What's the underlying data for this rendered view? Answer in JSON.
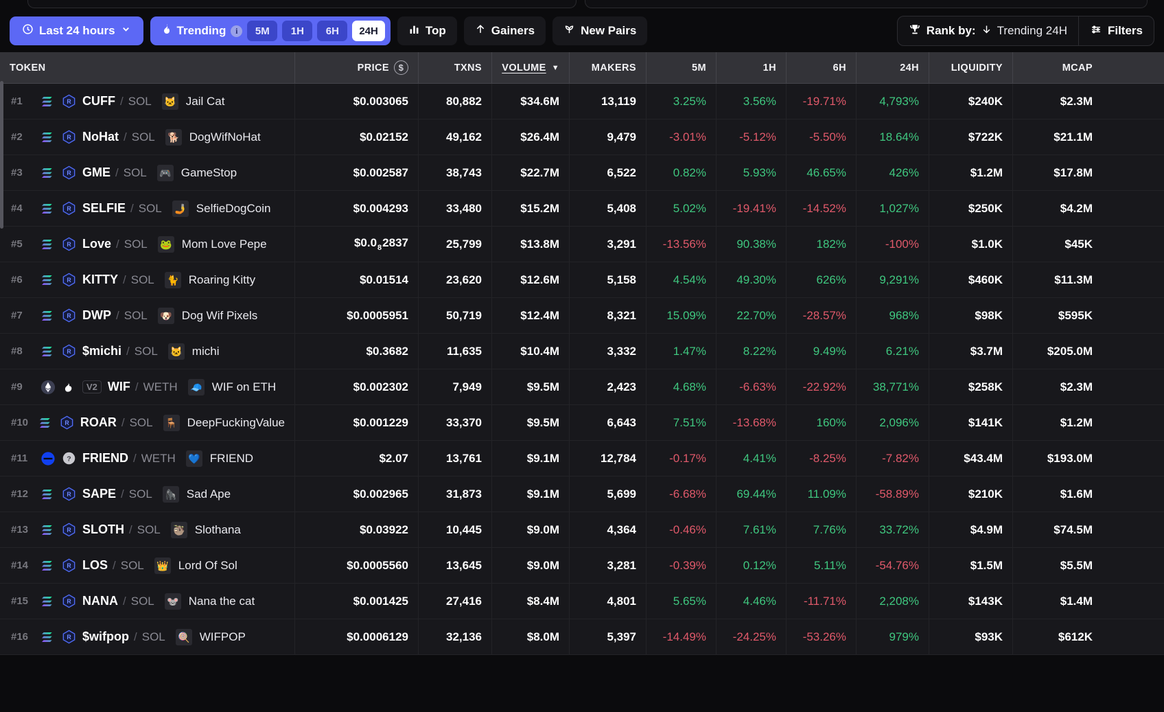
{
  "toolbar": {
    "timeframe_button": {
      "label": "Last 24 hours",
      "icon": "clock-icon",
      "chevron": "chevron-down-icon"
    },
    "trending": {
      "label": "Trending",
      "icon": "flame-icon",
      "info": "i",
      "options": [
        "5M",
        "1H",
        "6H",
        "24H"
      ],
      "active": "24H"
    },
    "tabs": [
      {
        "label": "Top",
        "icon": "bar-chart-icon"
      },
      {
        "label": "Gainers",
        "icon": "arrow-up-icon"
      },
      {
        "label": "New Pairs",
        "icon": "sprout-icon"
      }
    ],
    "rank_by": {
      "icon": "trophy-icon",
      "label": "Rank by:",
      "sort_icon": "arrow-down-icon",
      "value": "Trending 24H"
    },
    "filters": {
      "label": "Filters",
      "icon": "sliders-icon"
    }
  },
  "colors": {
    "accent": "#5c68f5",
    "up": "#3fc77f",
    "down": "#e0596a",
    "header_bg": "#333338",
    "row_bg": "#18181c"
  },
  "table": {
    "columns": [
      {
        "key": "token",
        "label": "TOKEN"
      },
      {
        "key": "price",
        "label": "PRICE",
        "badge": "$"
      },
      {
        "key": "txns",
        "label": "TXNS"
      },
      {
        "key": "volume",
        "label": "VOLUME",
        "sorted": true,
        "caret": "▼"
      },
      {
        "key": "makers",
        "label": "MAKERS"
      },
      {
        "key": "m5",
        "label": "5M"
      },
      {
        "key": "h1",
        "label": "1H"
      },
      {
        "key": "h6",
        "label": "6H"
      },
      {
        "key": "h24",
        "label": "24H"
      },
      {
        "key": "liquidity",
        "label": "LIQUIDITY"
      },
      {
        "key": "mcap",
        "label": "MCAP"
      }
    ],
    "rows": [
      {
        "rank": "#1",
        "chain": "solana-icon",
        "dex": "raydium-icon",
        "symbol": "CUFF",
        "quote": "SOL",
        "name": "Jail Cat",
        "avatar": "🐱",
        "price": "$0.003065",
        "txns": "80,882",
        "volume": "$34.6M",
        "makers": "13,119",
        "m5": "3.25%",
        "h1": "3.56%",
        "h6": "-19.71%",
        "h24": "4,793%",
        "liquidity": "$240K",
        "mcap": "$2.3M"
      },
      {
        "rank": "#2",
        "chain": "solana-icon",
        "dex": "raydium-icon",
        "symbol": "NoHat",
        "quote": "SOL",
        "name": "DogWifNoHat",
        "avatar": "🐕",
        "price": "$0.02152",
        "txns": "49,162",
        "volume": "$26.4M",
        "makers": "9,479",
        "m5": "-3.01%",
        "h1": "-5.12%",
        "h6": "-5.50%",
        "h24": "18.64%",
        "liquidity": "$722K",
        "mcap": "$21.1M"
      },
      {
        "rank": "#3",
        "chain": "solana-icon",
        "dex": "raydium-icon",
        "symbol": "GME",
        "quote": "SOL",
        "name": "GameStop",
        "avatar": "🎮",
        "price": "$0.002587",
        "txns": "38,743",
        "volume": "$22.7M",
        "makers": "6,522",
        "m5": "0.82%",
        "h1": "5.93%",
        "h6": "46.65%",
        "h24": "426%",
        "liquidity": "$1.2M",
        "mcap": "$17.8M"
      },
      {
        "rank": "#4",
        "chain": "solana-icon",
        "dex": "raydium-icon",
        "symbol": "SELFIE",
        "quote": "SOL",
        "name": "SelfieDogCoin",
        "avatar": "🤳",
        "price": "$0.004293",
        "txns": "33,480",
        "volume": "$15.2M",
        "makers": "5,408",
        "m5": "5.02%",
        "h1": "-19.41%",
        "h6": "-14.52%",
        "h24": "1,027%",
        "liquidity": "$250K",
        "mcap": "$4.2M"
      },
      {
        "rank": "#5",
        "chain": "solana-icon",
        "dex": "raydium-icon",
        "symbol": "Love",
        "quote": "SOL",
        "name": "Mom Love Pepe",
        "avatar": "🐸",
        "price": "$0.0",
        "price_sub": "8",
        "price_tail": "2837",
        "txns": "25,799",
        "volume": "$13.8M",
        "makers": "3,291",
        "m5": "-13.56%",
        "h1": "90.38%",
        "h6": "182%",
        "h24": "-100%",
        "liquidity": "$1.0K",
        "mcap": "$45K"
      },
      {
        "rank": "#6",
        "chain": "solana-icon",
        "dex": "raydium-icon",
        "symbol": "KITTY",
        "quote": "SOL",
        "name": "Roaring Kitty",
        "avatar": "🐈",
        "price": "$0.01514",
        "txns": "23,620",
        "volume": "$12.6M",
        "makers": "5,158",
        "m5": "4.54%",
        "h1": "49.30%",
        "h6": "626%",
        "h24": "9,291%",
        "liquidity": "$460K",
        "mcap": "$11.3M"
      },
      {
        "rank": "#7",
        "chain": "solana-icon",
        "dex": "raydium-icon",
        "symbol": "DWP",
        "quote": "SOL",
        "name": "Dog Wif Pixels",
        "avatar": "🐶",
        "price": "$0.0005951",
        "txns": "50,719",
        "volume": "$12.4M",
        "makers": "8,321",
        "m5": "15.09%",
        "h1": "22.70%",
        "h6": "-28.57%",
        "h24": "968%",
        "liquidity": "$98K",
        "mcap": "$595K"
      },
      {
        "rank": "#8",
        "chain": "solana-icon",
        "dex": "raydium-icon",
        "symbol": "$michi",
        "quote": "SOL",
        "name": "michi",
        "avatar": "🐱",
        "price": "$0.3682",
        "txns": "11,635",
        "volume": "$10.4M",
        "makers": "3,332",
        "m5": "1.47%",
        "h1": "8.22%",
        "h6": "9.49%",
        "h24": "6.21%",
        "liquidity": "$3.7M",
        "mcap": "$205.0M"
      },
      {
        "rank": "#9",
        "chain": "ethereum-icon",
        "dex": "uniswap-icon",
        "version": "V2",
        "symbol": "WIF",
        "quote": "WETH",
        "name": "WIF on ETH",
        "avatar": "🧢",
        "price": "$0.002302",
        "txns": "7,949",
        "volume": "$9.5M",
        "makers": "2,423",
        "m5": "4.68%",
        "h1": "-6.63%",
        "h6": "-22.92%",
        "h24": "38,771%",
        "liquidity": "$258K",
        "mcap": "$2.3M"
      },
      {
        "rank": "#10",
        "chain": "solana-icon",
        "dex": "raydium-icon",
        "symbol": "ROAR",
        "quote": "SOL",
        "name": "DeepFuckingValue",
        "avatar": "🪑",
        "price": "$0.001229",
        "txns": "33,370",
        "volume": "$9.5M",
        "makers": "6,643",
        "m5": "7.51%",
        "h1": "-13.68%",
        "h6": "160%",
        "h24": "2,096%",
        "liquidity": "$141K",
        "mcap": "$1.2M"
      },
      {
        "rank": "#11",
        "chain": "base-icon",
        "dex": "unknown-dex-icon",
        "symbol": "FRIEND",
        "quote": "WETH",
        "name": "FRIEND",
        "avatar": "💙",
        "price": "$2.07",
        "txns": "13,761",
        "volume": "$9.1M",
        "makers": "12,784",
        "m5": "-0.17%",
        "h1": "4.41%",
        "h6": "-8.25%",
        "h24": "-7.82%",
        "liquidity": "$43.4M",
        "mcap": "$193.0M"
      },
      {
        "rank": "#12",
        "chain": "solana-icon",
        "dex": "raydium-icon",
        "symbol": "SAPE",
        "quote": "SOL",
        "name": "Sad Ape",
        "avatar": "🦍",
        "price": "$0.002965",
        "txns": "31,873",
        "volume": "$9.1M",
        "makers": "5,699",
        "m5": "-6.68%",
        "h1": "69.44%",
        "h6": "11.09%",
        "h24": "-58.89%",
        "liquidity": "$210K",
        "mcap": "$1.6M"
      },
      {
        "rank": "#13",
        "chain": "solana-icon",
        "dex": "raydium-icon",
        "symbol": "SLOTH",
        "quote": "SOL",
        "name": "Slothana",
        "avatar": "🦥",
        "price": "$0.03922",
        "txns": "10,445",
        "volume": "$9.0M",
        "makers": "4,364",
        "m5": "-0.46%",
        "h1": "7.61%",
        "h6": "7.76%",
        "h24": "33.72%",
        "liquidity": "$4.9M",
        "mcap": "$74.5M"
      },
      {
        "rank": "#14",
        "chain": "solana-icon",
        "dex": "raydium-icon",
        "symbol": "LOS",
        "quote": "SOL",
        "name": "Lord Of Sol",
        "avatar": "👑",
        "price": "$0.0005560",
        "txns": "13,645",
        "volume": "$9.0M",
        "makers": "3,281",
        "m5": "-0.39%",
        "h1": "0.12%",
        "h6": "5.11%",
        "h24": "-54.76%",
        "liquidity": "$1.5M",
        "mcap": "$5.5M"
      },
      {
        "rank": "#15",
        "chain": "solana-icon",
        "dex": "raydium-icon",
        "symbol": "NANA",
        "quote": "SOL",
        "name": "Nana the cat",
        "avatar": "🐭",
        "price": "$0.001425",
        "txns": "27,416",
        "volume": "$8.4M",
        "makers": "4,801",
        "m5": "5.65%",
        "h1": "4.46%",
        "h6": "-11.71%",
        "h24": "2,208%",
        "liquidity": "$143K",
        "mcap": "$1.4M"
      },
      {
        "rank": "#16",
        "chain": "solana-icon",
        "dex": "raydium-icon",
        "symbol": "$wifpop",
        "quote": "SOL",
        "name": "WIFPOP",
        "avatar": "🍭",
        "price": "$0.0006129",
        "txns": "32,136",
        "volume": "$8.0M",
        "makers": "5,397",
        "m5": "-14.49%",
        "h1": "-24.25%",
        "h6": "-53.26%",
        "h24": "979%",
        "liquidity": "$93K",
        "mcap": "$612K"
      }
    ]
  }
}
